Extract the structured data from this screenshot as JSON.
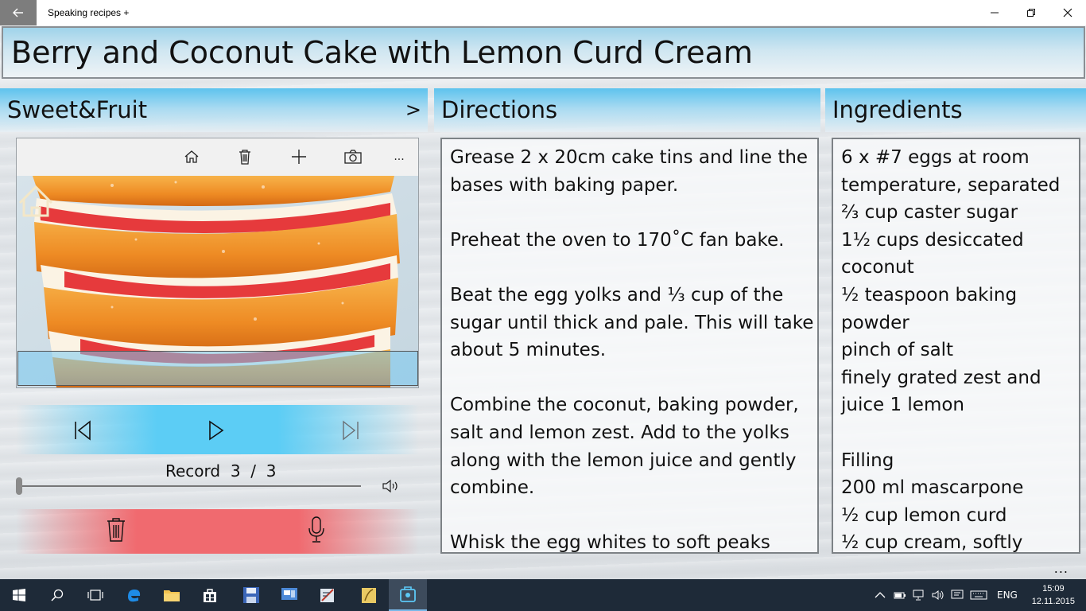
{
  "window": {
    "title": "Speaking recipes +"
  },
  "recipe": {
    "title": "Berry and Coconut Cake with Lemon Curd Cream",
    "category": "Sweet&Fruit",
    "next_label": ">"
  },
  "player": {
    "record_label": "Record",
    "record_current": "3",
    "record_separator": "/",
    "record_total": "3",
    "position": 0
  },
  "directions": {
    "heading": "Directions",
    "lines": [
      "Grease 2 x 20cm cake tins and line the",
      "bases with baking paper.",
      "",
      "Preheat the oven to 170˚C fan bake.",
      "",
      "Beat the egg yolks and ⅓ cup of the",
      "sugar until thick and pale. This will take",
      "about 5 minutes.",
      "",
      "Combine the coconut, baking powder,",
      "salt and lemon zest. Add to the yolks",
      "along with the lemon juice and gently",
      "combine.",
      "",
      "Whisk the egg whites to soft peaks"
    ]
  },
  "ingredients": {
    "heading": "Ingredients",
    "lines": [
      "6 x #7 eggs at room",
      "temperature, separated",
      "⅔ cup caster sugar",
      "1½ cups desiccated",
      "coconut",
      "½ teaspoon baking",
      "powder",
      "pinch of salt",
      "finely grated zest and",
      "juice 1 lemon",
      "",
      "Filling",
      "200 ml mascarpone",
      "½ cup lemon curd",
      "½ cup cream, softly"
    ]
  },
  "more_label": "...",
  "taskbar": {
    "language": "ENG",
    "time": "15:09",
    "date": "12.11.2015"
  },
  "icons": {
    "back": "arrow-left-icon",
    "minimize": "minimize-icon",
    "maximize": "restore-icon",
    "close": "close-icon"
  },
  "colors": {
    "accent_blue": "#5ec3ee",
    "record_red": "#f06a6f",
    "taskbar": "#1e2a38"
  }
}
